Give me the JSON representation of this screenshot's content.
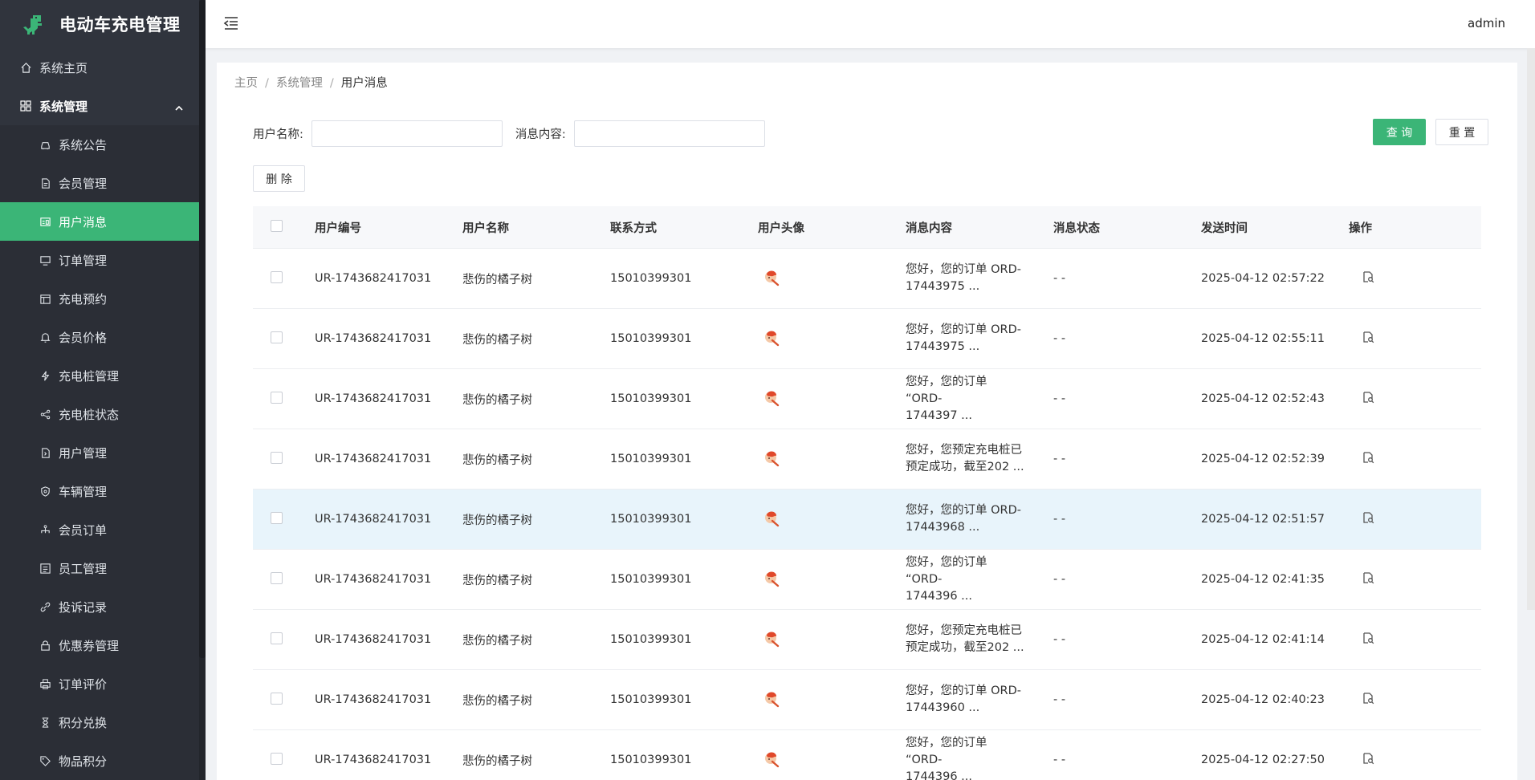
{
  "app": {
    "title": "电动车充电管理",
    "brand_color": "#3bb577"
  },
  "header": {
    "user": "admin"
  },
  "sidebar": {
    "home": "系统主页",
    "group": "系统管理",
    "items": [
      {
        "label": "系统公告",
        "icon": "car-icon"
      },
      {
        "label": "会员管理",
        "icon": "document-icon"
      },
      {
        "label": "用户消息",
        "icon": "message-card-icon",
        "active": true
      },
      {
        "label": "订单管理",
        "icon": "monitor-icon"
      },
      {
        "label": "充电预约",
        "icon": "calendar-icon"
      },
      {
        "label": "会员价格",
        "icon": "bell-icon"
      },
      {
        "label": "充电桩管理",
        "icon": "lightning-icon"
      },
      {
        "label": "充电桩状态",
        "icon": "share-icon"
      },
      {
        "label": "用户管理",
        "icon": "file-icon"
      },
      {
        "label": "车辆管理",
        "icon": "shield-icon"
      },
      {
        "label": "会员订单",
        "icon": "sitemap-icon"
      },
      {
        "label": "员工管理",
        "icon": "list-icon"
      },
      {
        "label": "投诉记录",
        "icon": "link-icon"
      },
      {
        "label": "优惠券管理",
        "icon": "lock-icon"
      },
      {
        "label": "订单评价",
        "icon": "printer-icon"
      },
      {
        "label": "积分兑换",
        "icon": "hourglass-icon"
      },
      {
        "label": "物品积分",
        "icon": "tag-icon"
      }
    ]
  },
  "breadcrumb": [
    "主页",
    "系统管理",
    "用户消息"
  ],
  "search": {
    "username_label": "用户名称:",
    "username_value": "",
    "content_label": "消息内容:",
    "content_value": "",
    "query_label": "查 询",
    "reset_label": "重 置"
  },
  "actions": {
    "delete_label": "删 除"
  },
  "table": {
    "columns": [
      "用户编号",
      "用户名称",
      "联系方式",
      "用户头像",
      "消息内容",
      "消息状态",
      "发送时间",
      "操作"
    ],
    "rows": [
      {
        "id": "UR-1743682417031",
        "name": "悲伤的橘子树",
        "phone": "15010399301",
        "msg1": "您好，您的订单 ORD-",
        "msg2": "17443975 ...",
        "status": "- -",
        "time": "2025-04-12 02:57:22"
      },
      {
        "id": "UR-1743682417031",
        "name": "悲伤的橘子树",
        "phone": "15010399301",
        "msg1": "您好，您的订单 ORD-",
        "msg2": "17443975 ...",
        "status": "- -",
        "time": "2025-04-12 02:55:11"
      },
      {
        "id": "UR-1743682417031",
        "name": "悲伤的橘子树",
        "phone": "15010399301",
        "msg1": "您好，您的订单 “ORD-",
        "msg2": "1744397 ...",
        "status": "- -",
        "time": "2025-04-12 02:52:43"
      },
      {
        "id": "UR-1743682417031",
        "name": "悲伤的橘子树",
        "phone": "15010399301",
        "msg1": "您好，您预定充电桩已",
        "msg2": "预定成功，截至202 ...",
        "status": "- -",
        "time": "2025-04-12 02:52:39"
      },
      {
        "id": "UR-1743682417031",
        "name": "悲伤的橘子树",
        "phone": "15010399301",
        "msg1": "您好，您的订单 ORD-",
        "msg2": "17443968 ...",
        "status": "- -",
        "time": "2025-04-12 02:51:57",
        "hover": true
      },
      {
        "id": "UR-1743682417031",
        "name": "悲伤的橘子树",
        "phone": "15010399301",
        "msg1": "您好，您的订单 “ORD-",
        "msg2": "1744396 ...",
        "status": "- -",
        "time": "2025-04-12 02:41:35"
      },
      {
        "id": "UR-1743682417031",
        "name": "悲伤的橘子树",
        "phone": "15010399301",
        "msg1": "您好，您预定充电桩已",
        "msg2": "预定成功，截至202 ...",
        "status": "- -",
        "time": "2025-04-12 02:41:14"
      },
      {
        "id": "UR-1743682417031",
        "name": "悲伤的橘子树",
        "phone": "15010399301",
        "msg1": "您好，您的订单 ORD-",
        "msg2": "17443960 ...",
        "status": "- -",
        "time": "2025-04-12 02:40:23"
      },
      {
        "id": "UR-1743682417031",
        "name": "悲伤的橘子树",
        "phone": "15010399301",
        "msg1": "您好，您的订单 “ORD-",
        "msg2": "1744396 ...",
        "status": "- -",
        "time": "2025-04-12 02:27:50"
      }
    ]
  }
}
